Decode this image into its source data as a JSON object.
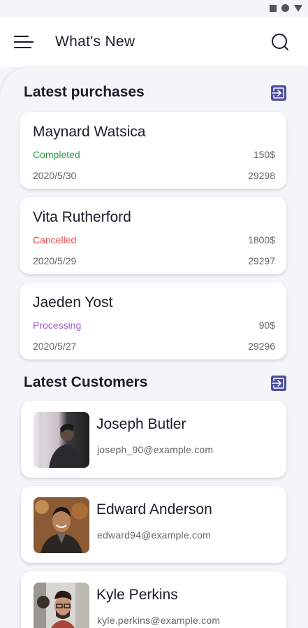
{
  "app": {
    "title": "What's New"
  },
  "purchases": {
    "section_title": "Latest purchases",
    "items": [
      {
        "name": "Maynard Watsica",
        "status": "Completed",
        "status_color": "#2e9b4f",
        "amount": "150$",
        "date": "2020/5/30",
        "id": "29298"
      },
      {
        "name": "Vita Rutherford",
        "status": "Cancelled",
        "status_color": "#e04b47",
        "amount": "1800$",
        "date": "2020/5/29",
        "id": "29297"
      },
      {
        "name": "Jaeden Yost",
        "status": "Processing",
        "status_color": "#a65bc4",
        "amount": "90$",
        "date": "2020/5/27",
        "id": "29296"
      }
    ]
  },
  "customers": {
    "section_title": "Latest Customers",
    "items": [
      {
        "name": "Joseph Butler",
        "email": "joseph_90@example.com"
      },
      {
        "name": "Edward Anderson",
        "email": "edward94@example.com"
      },
      {
        "name": "Kyle Perkins",
        "email": "kyle.perkins@example.com"
      }
    ]
  },
  "colors": {
    "accent": "#4b4e9e",
    "background": "#f4f5f9",
    "card": "#ffffff"
  }
}
